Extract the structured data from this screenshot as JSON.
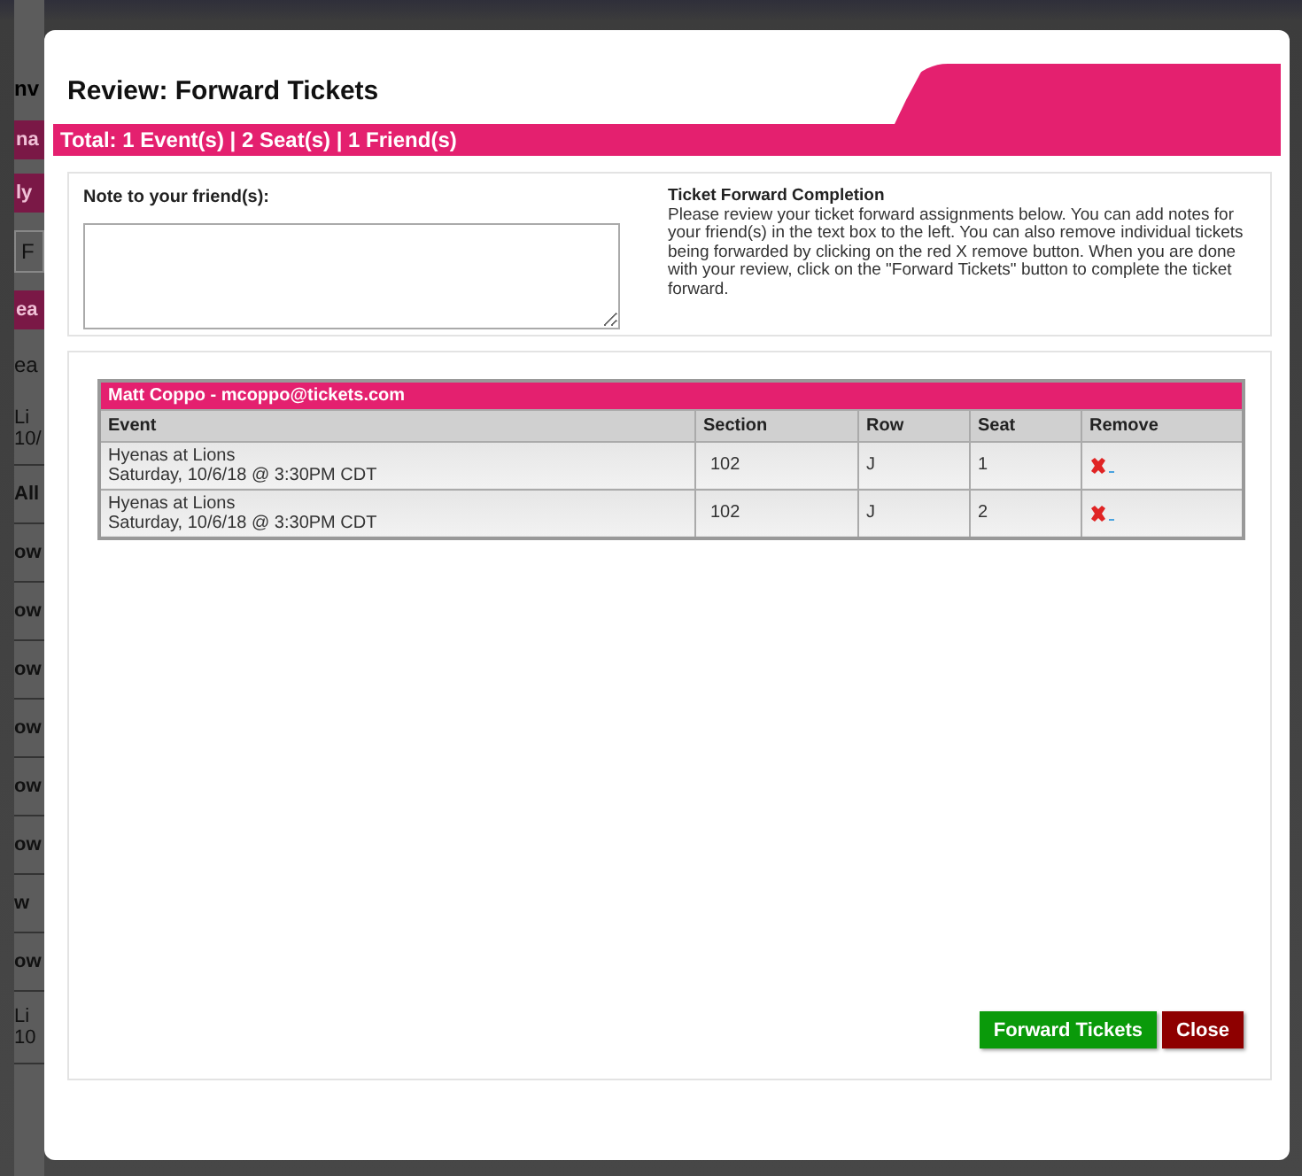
{
  "background_page": [
    {
      "kind": "heading",
      "text": "nv"
    },
    {
      "kind": "bar",
      "text": "na"
    },
    {
      "kind": "bar",
      "text": "ly"
    },
    {
      "kind": "field",
      "text": "F"
    },
    {
      "kind": "bar",
      "text": "ea"
    },
    {
      "kind": "text",
      "text": "ea"
    },
    {
      "kind": "double",
      "text": "Li",
      "sub": "10/"
    },
    {
      "kind": "row",
      "text": "All"
    },
    {
      "kind": "row",
      "text": "ow"
    },
    {
      "kind": "row",
      "text": "ow"
    },
    {
      "kind": "row",
      "text": "ow"
    },
    {
      "kind": "row",
      "text": "ow"
    },
    {
      "kind": "row",
      "text": "ow"
    },
    {
      "kind": "row",
      "text": "ow"
    },
    {
      "kind": "row",
      "text": "w"
    },
    {
      "kind": "row",
      "text": "ow"
    },
    {
      "kind": "double",
      "text": "Li",
      "sub": "10"
    }
  ],
  "dialog": {
    "title": "Review: Forward Tickets",
    "summary": "Total: 1 Event(s) | 2 Seat(s) | 1 Friend(s)",
    "note": {
      "label": "Note to your friend(s):"
    },
    "info": {
      "title": "Ticket Forward Completion",
      "text": "Please review your ticket forward assignments below. You can add notes for your friend(s) in the text box to the left. You can also remove individual tickets being forwarded by clicking on the red X remove button. When you are done with your review, click on the \"Forward Tickets\" button to complete the ticket forward."
    },
    "friends": [
      {
        "header": "Matt Coppo - mcoppo@tickets.com",
        "columns": [
          "Event",
          "Section",
          "Row",
          "Seat",
          "Remove"
        ],
        "rows": [
          {
            "event": "Hyenas at Lions",
            "date": "Saturday, 10/6/18 @ 3:30PM CDT",
            "section": "102",
            "row": "J",
            "seat": "1"
          },
          {
            "event": "Hyenas at Lions",
            "date": "Saturday, 10/6/18 @ 3:30PM CDT",
            "section": "102",
            "row": "J",
            "seat": "2"
          }
        ]
      }
    ],
    "buttons": [
      {
        "kind": "primary",
        "label": "Forward Tickets"
      },
      {
        "kind": "danger",
        "label": "Close"
      }
    ]
  }
}
